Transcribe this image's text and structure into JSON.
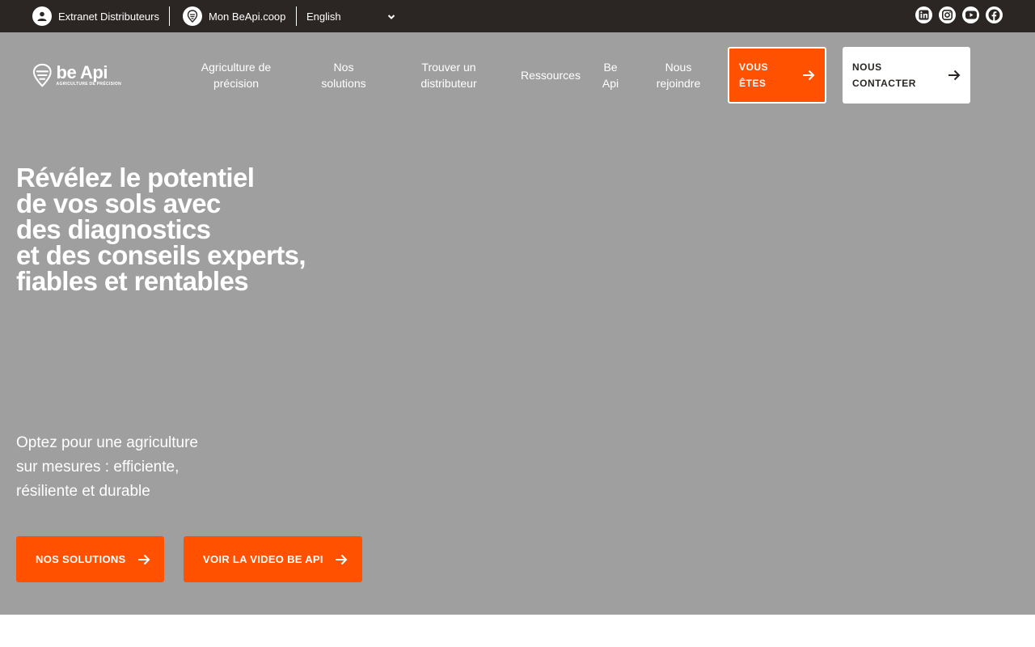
{
  "topbar": {
    "extranet": {
      "label": "Extranet Distributeurs",
      "icon": "user-icon"
    },
    "monbeapi": {
      "label": "Mon BeApi.coop",
      "icon": "beapi-pin-icon"
    },
    "language": {
      "selected": "English",
      "icon": "chevron-down-icon"
    },
    "socials": [
      "linkedin-icon",
      "instagram-icon",
      "youtube-icon",
      "facebook-icon"
    ]
  },
  "logo": {
    "brand": "be Api",
    "tagline": "AGRICULTURE DE PRÉCISION"
  },
  "nav": {
    "items": [
      {
        "label": "Agriculture de précision"
      },
      {
        "label": "Nos solutions"
      },
      {
        "label": "Trouver un distributeur"
      },
      {
        "label": "Ressources"
      },
      {
        "label": "Be Api"
      },
      {
        "label": "Nous rejoindre"
      }
    ],
    "you_are": "VOUS ÊTES",
    "contact": "NOUS CONTACTER"
  },
  "hero": {
    "headline": "Révélez le potentiel\nde vos sols avec\ndes diagnostics\net des conseils experts,\nfiables et rentables",
    "subtitle": "Optez pour une agriculture\nsur mesures : efficiente,\nrésiliente et durable",
    "cta_primary": "NOS SOLUTIONS",
    "cta_video": "VOIR LA VIDEO BE API"
  },
  "colors": {
    "accent": "#ff5100",
    "topbar": "#2b2624",
    "hero_bg": "#9f9f9f"
  }
}
